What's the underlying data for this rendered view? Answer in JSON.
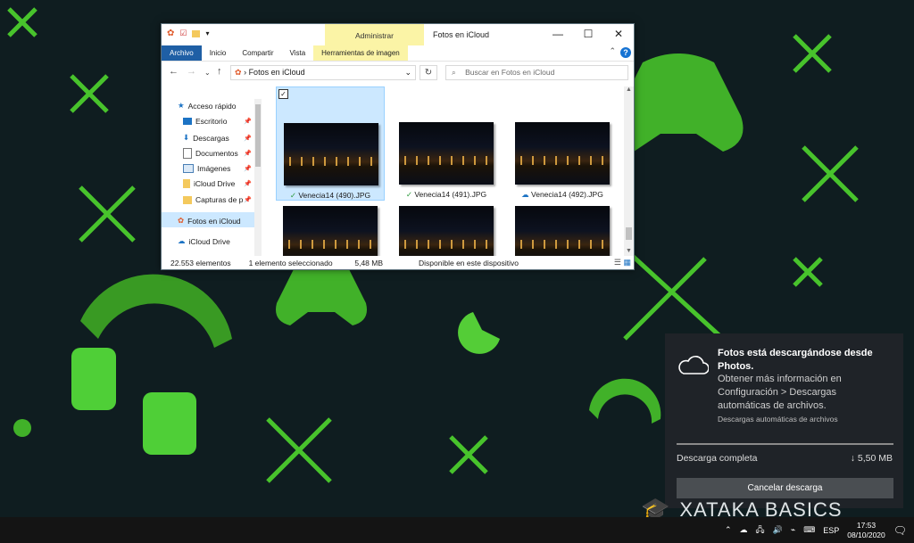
{
  "explorer": {
    "title": "Fotos en iCloud",
    "context_group": "Administrar",
    "tabs": [
      "Archivo",
      "Inicio",
      "Compartir",
      "Vista",
      "Herramientas de imagen"
    ],
    "path": "Fotos en iCloud",
    "search_placeholder": "Buscar en Fotos en iCloud",
    "nav_items": [
      {
        "label": "Acceso rápido",
        "icon": "star-icon",
        "pinned": false
      },
      {
        "label": "Escritorio",
        "icon": "desktop-icon",
        "pinned": true
      },
      {
        "label": "Descargas",
        "icon": "download-icon",
        "pinned": true
      },
      {
        "label": "Documentos",
        "icon": "document-icon",
        "pinned": true
      },
      {
        "label": "Imágenes",
        "icon": "image-icon",
        "pinned": true
      },
      {
        "label": "iCloud Drive",
        "icon": "icloud-drive-icon",
        "pinned": true
      },
      {
        "label": "Capturas de p",
        "icon": "folder-icon",
        "pinned": true
      },
      {
        "label": "Fotos en iCloud",
        "icon": "photos-icon",
        "pinned": false,
        "selected": true
      },
      {
        "label": "iCloud Drive",
        "icon": "icloud-icon",
        "pinned": false
      }
    ],
    "files": [
      {
        "name": "Venecia14 (490).JPG",
        "status": "✓",
        "selected": true
      },
      {
        "name": "Venecia14 (491).JPG",
        "status": "✓",
        "selected": false
      },
      {
        "name": "Venecia14 (492).JPG",
        "status": "☁",
        "selected": false
      },
      {
        "name": "",
        "status": "",
        "selected": false
      },
      {
        "name": "",
        "status": "",
        "selected": false
      },
      {
        "name": "",
        "status": "",
        "selected": false
      }
    ],
    "status": {
      "count": "22.553 elementos",
      "selection": "1 elemento seleccionado",
      "size": "5,48 MB",
      "availability": "Disponible en este dispositivo"
    }
  },
  "notification": {
    "title": "Fotos está descargándose desde Photos.",
    "body": "Obtener más información en Configuración > Descargas automáticas de archivos.",
    "source": "Descargas automáticas de archivos",
    "progress_label": "Descarga completa",
    "size": "↓ 5,50 MB",
    "button": "Cancelar descarga"
  },
  "taskbar": {
    "language": "ESP",
    "time": "17:53",
    "date": "08/10/2020"
  },
  "watermark": "XATAKA BASICS",
  "colors": {
    "accent": "#1f5fa5",
    "desktop_green": "#4fd62e",
    "selection": "#cce8ff"
  }
}
